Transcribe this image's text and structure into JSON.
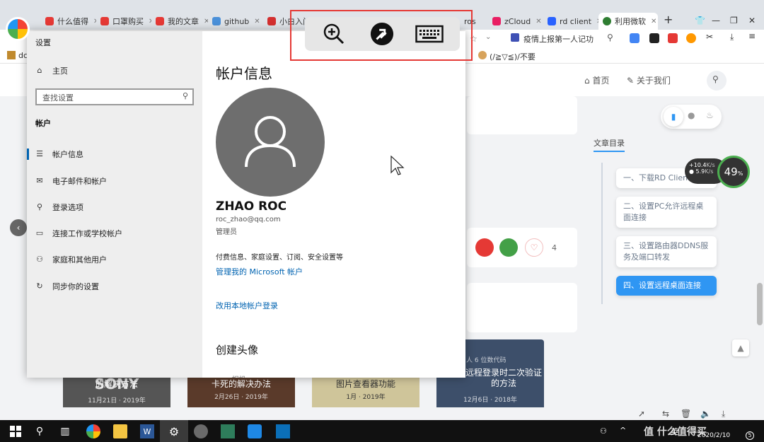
{
  "browser": {
    "tabs": [
      {
        "label": "什么值得",
        "color": "#e53935"
      },
      {
        "label": "口罩购买",
        "color": "#e53935"
      },
      {
        "label": "我的文章",
        "color": "#e53935"
      },
      {
        "label": "github",
        "color": "#4a90d9"
      },
      {
        "label": "小白入门",
        "color": "#d32f2f"
      },
      {
        "label": "ros",
        "color": "#888888"
      },
      {
        "label": "zCloud",
        "color": "#e91e63"
      },
      {
        "label": "rd client",
        "color": "#2962ff"
      },
      {
        "label": "利用微软",
        "color": "#2e7d32"
      }
    ],
    "address_text": "疫情上报第一人记功",
    "bookmark_left": "dc",
    "bookmark_right": "(/≧▽≦)/不要"
  },
  "site": {
    "nav": {
      "home": "首页",
      "about": "关于我们"
    },
    "share_count": "4",
    "toc": {
      "title": "文章目录",
      "items": [
        {
          "label": "一、下载RD Client",
          "active": false
        },
        {
          "label": "二、设置PC允许远程桌面连接",
          "active": false
        },
        {
          "label": "三、设置路由器DDNS服务及端口转发",
          "active": false
        },
        {
          "label": "四、设置远程桌面连接",
          "active": true
        }
      ]
    },
    "netspeed": {
      "up": "+10.4",
      "up_unit": "K/s",
      "down": "5.9",
      "down_unit": "K/s",
      "percent": "49",
      "percent_unit": "%"
    },
    "thumbs": [
      {
        "title": "的解决方法",
        "date": "11月21日 · 2019年",
        "brand": "SONY"
      },
      {
        "title": "卡死的解决办法",
        "date": "2月26日 · 2019年"
      },
      {
        "title": "图片查看器功能",
        "date": "1月 · 2019年"
      },
      {
        "title": "远程登录时二次验证的方法",
        "date": "12月6日 · 2018年",
        "meta": "人 6  位数代码"
      }
    ]
  },
  "settings": {
    "window_title": "设置",
    "home": "主页",
    "search_placeholder": "查找设置",
    "section": "帐户",
    "nav": [
      {
        "label": "帐户信息",
        "icon": "☰"
      },
      {
        "label": "电子邮件和帐户",
        "icon": "✉"
      },
      {
        "label": "登录选项",
        "icon": "⚲"
      },
      {
        "label": "连接工作或学校帐户",
        "icon": "▭"
      },
      {
        "label": "家庭和其他用户",
        "icon": "⚇"
      },
      {
        "label": "同步你的设置",
        "icon": "↻"
      }
    ],
    "heading": "帐户信息",
    "user_name": "ZHAO ROC",
    "email": "roc_zhao@qq.com",
    "role": "管理员",
    "billing": "付费信息、家庭设置、订阅、安全设置等",
    "manage_link": "管理我的 Microsoft 帐户",
    "local_link": "改用本地帐户登录",
    "avatar_heading": "创建头像",
    "avatar_option": "相机"
  },
  "taskbar": {
    "ime": "英",
    "date": "2020/2/10",
    "watermark": "值 什么值得买",
    "notify_count": "5"
  },
  "colors": {
    "accent": "#0063b1",
    "toc_active": "#2f96f3",
    "frame": "#e53935"
  }
}
